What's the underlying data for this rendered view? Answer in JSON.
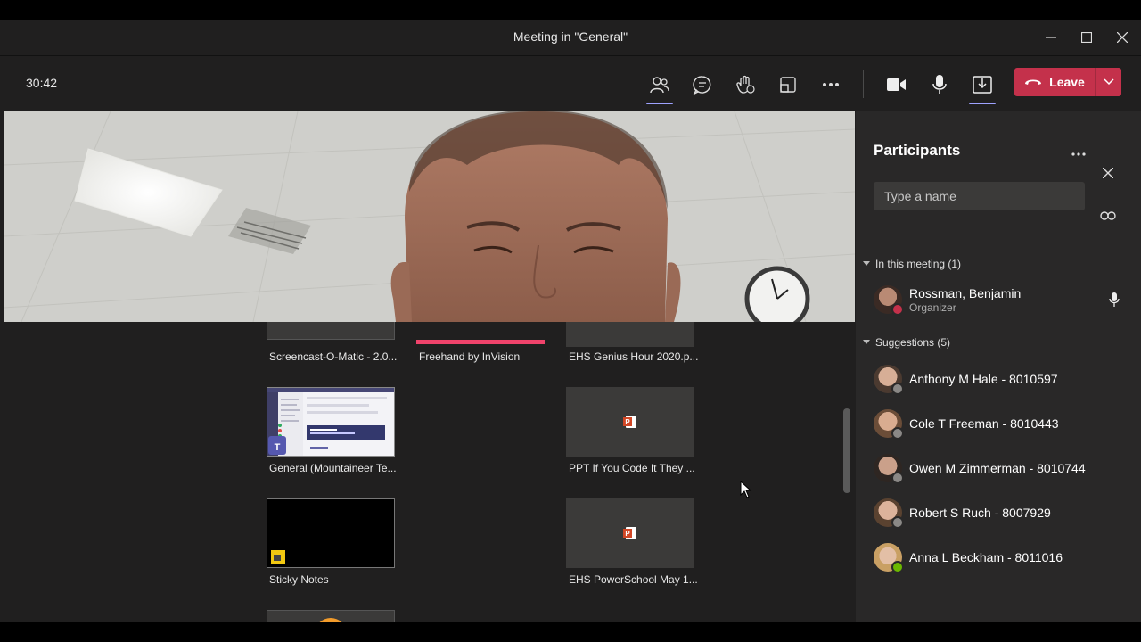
{
  "window": {
    "title": "Meeting in \"General\""
  },
  "toolbar": {
    "timer": "30:42",
    "leave_label": "Leave"
  },
  "panel": {
    "title": "Participants",
    "search_placeholder": "Type a name",
    "in_meeting_label": "In this meeting (1)",
    "suggestions_label": "Suggestions (5)",
    "in_meeting": [
      {
        "name": "Rossman, Benjamin",
        "role": "Organizer"
      }
    ],
    "suggestions": [
      {
        "name": "Anthony M Hale - 8010597"
      },
      {
        "name": "Cole T Freeman - 8010443"
      },
      {
        "name": "Owen M Zimmerman - 8010744"
      },
      {
        "name": "Robert S Ruch - 8007929"
      },
      {
        "name": "Anna L Beckham - 8011016"
      }
    ]
  },
  "share_tray": {
    "items": [
      {
        "label": "Screencast-O-Matic - 2.0..."
      },
      {
        "label": "Freehand by InVision"
      },
      {
        "label": "EHS Genius Hour 2020.p..."
      },
      {
        "label": "General (Mountaineer Te..."
      },
      {
        "label": "PPT If You Code It They ..."
      },
      {
        "label": "Sticky Notes"
      },
      {
        "label": "EHS PowerSchool May 1..."
      }
    ]
  },
  "colors": {
    "leave": "#c4314b",
    "accent": "#9ea2ff",
    "panel": "#292828",
    "stage": "#201f1f"
  }
}
